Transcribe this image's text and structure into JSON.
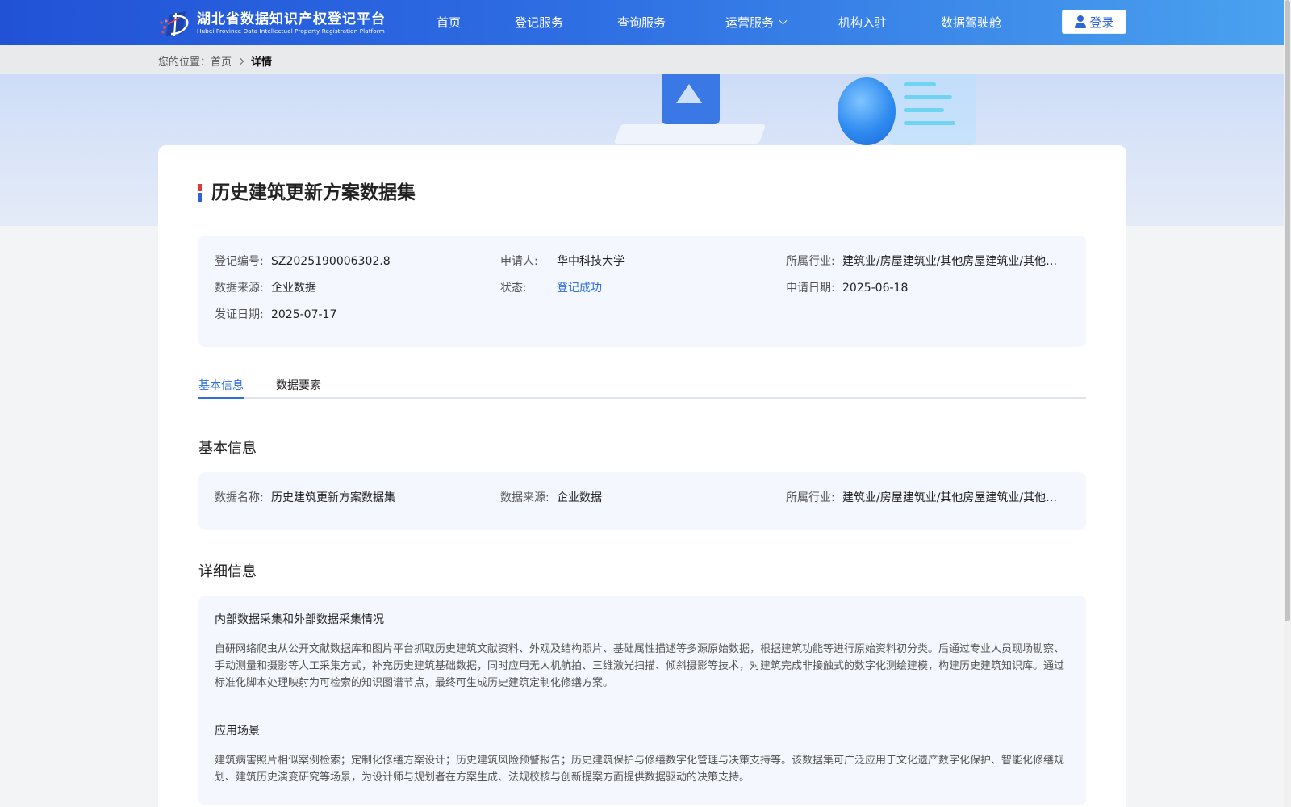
{
  "header": {
    "logo_cn": "湖北省数据知识产权登记平台",
    "logo_en": "Hubei Province Data Intellectual Property Registration Platform",
    "nav": [
      {
        "label": "首页"
      },
      {
        "label": "登记服务"
      },
      {
        "label": "查询服务"
      },
      {
        "label": "运营服务"
      },
      {
        "label": "机构入驻"
      },
      {
        "label": "数据驾驶舱"
      }
    ],
    "login_label": "登录"
  },
  "breadcrumb": {
    "prefix": "您的位置：",
    "home": "首页",
    "current": "详情"
  },
  "record": {
    "title": "历史建筑更新方案数据集",
    "fields": {
      "reg_no_label": "登记编号:",
      "reg_no": "SZ2025190006302.8",
      "applicant_label": "申请人:",
      "applicant": "华中科技大学",
      "industry_label": "所属行业:",
      "industry": "建筑业/房屋建筑业/其他房屋建筑业/其他…",
      "source_label": "数据来源:",
      "source": "企业数据",
      "status_label": "状态:",
      "status": "登记成功",
      "apply_date_label": "申请日期:",
      "apply_date": "2025-06-18",
      "issue_date_label": "发证日期:",
      "issue_date": "2025-07-17"
    }
  },
  "tabs": [
    {
      "label": "基本信息",
      "active": true
    },
    {
      "label": "数据要素",
      "active": false
    }
  ],
  "basic": {
    "section_title": "基本信息",
    "name_label": "数据名称:",
    "name": "历史建筑更新方案数据集",
    "source_label": "数据来源:",
    "source": "企业数据",
    "industry_label": "所属行业:",
    "industry": "建筑业/房屋建筑业/其他房屋建筑业/其他…"
  },
  "detail": {
    "section_title": "详细信息",
    "collection_title": "内部数据采集和外部数据采集情况",
    "collection_text": "自研网络爬虫从公开文献数据库和图片平台抓取历史建筑文献资料、外观及结构照片、基础属性描述等多源原始数据，根据建筑功能等进行原始资料初分类。后通过专业人员现场勘察、手动测量和摄影等人工采集方式，补充历史建筑基础数据，同时应用无人机航拍、三维激光扫描、倾斜摄影等技术，对建筑完成非接触式的数字化测绘建模，构建历史建筑知识库。通过标准化脚本处理映射为可检索的知识图谱节点，最终可生成历史建筑定制化修缮方案。",
    "scenario_title": "应用场景",
    "scenario_text": "建筑病害照片相似案例检索；定制化修缮方案设计；历史建筑风险预警报告；历史建筑保护与修缮数字化管理与决策支持等。该数据集可广泛应用于文化遗产数字化保护、智能化修缮规划、建筑历史演变研究等场景，为设计师与规划者在方案生成、法规校核与创新提案方面提供数据驱动的决策支持。"
  },
  "colors": {
    "header_start": "#2152d6",
    "header_end": "#4aa2ef",
    "accent": "#2e6ee3",
    "panel_bg": "#f4f7fd"
  }
}
